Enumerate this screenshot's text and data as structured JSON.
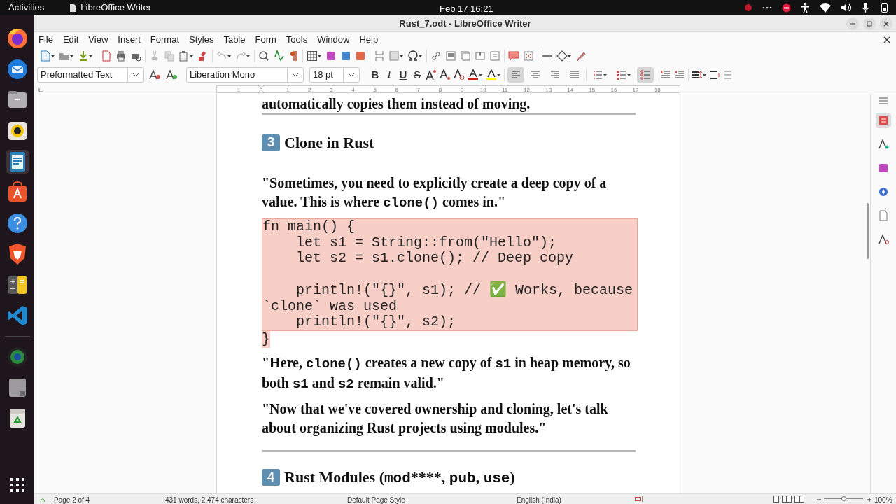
{
  "top_bar": {
    "activities": "Activities",
    "app": "LibreOffice Writer",
    "clock": "Feb 17  16:21"
  },
  "window": {
    "title": "Rust_7.odt - LibreOffice Writer"
  },
  "menu": [
    "File",
    "Edit",
    "View",
    "Insert",
    "Format",
    "Styles",
    "Table",
    "Form",
    "Tools",
    "Window",
    "Help"
  ],
  "formatting": {
    "paragraph_style": "Preformatted Text",
    "font_name": "Liberation Mono",
    "font_size": "18 pt",
    "text_buttons": [
      {
        "kind": "bold",
        "label": "B"
      },
      {
        "kind": "italic",
        "label": "I"
      },
      {
        "kind": "underline",
        "label": "U"
      },
      {
        "kind": "strike",
        "label": "S"
      }
    ],
    "paragraph_buttons": [
      {
        "kind": "align-left",
        "selected": true
      },
      {
        "kind": "align-center",
        "selected": false
      },
      {
        "kind": "align-right",
        "selected": false
      },
      {
        "kind": "justify",
        "selected": false
      },
      {
        "kind": "bullets",
        "selected": false
      },
      {
        "kind": "numbering",
        "selected": false
      },
      {
        "kind": "outline",
        "selected": true
      }
    ]
  },
  "ruler": {
    "left_label": "1",
    "labels": [
      "1",
      "2",
      "3",
      "4",
      "5",
      "6",
      "7",
      "8",
      "9",
      "10",
      "11",
      "12",
      "13",
      "14",
      "15",
      "16",
      "17",
      "18"
    ]
  },
  "document": {
    "blocks": [
      {
        "kind": "cut",
        "text": "automatically copies them instead of moving."
      },
      {
        "kind": "rule"
      },
      {
        "kind": "heading",
        "number": "3",
        "segments": [
          {
            "text": "Clone in Rust",
            "code": false
          }
        ]
      },
      {
        "kind": "paragraph",
        "segments": [
          {
            "text": "\"Sometimes, you need to explicitly create a deep copy of a value. This is where ",
            "code": false
          },
          {
            "text": "clone()",
            "code": true
          },
          {
            "text": " comes in.\"",
            "code": false
          }
        ]
      },
      {
        "kind": "code",
        "lines": [
          {
            "kind": "text",
            "text": "fn main() {"
          },
          {
            "kind": "text",
            "text": "    let s1 = String::from(\"Hello\");"
          },
          {
            "kind": "text",
            "text": "    let s2 = s1.clone(); // Deep copy"
          },
          {
            "kind": "blank"
          },
          {
            "kind": "text",
            "text": "    println!(\"{}\", s1); // ✅ Works, because"
          },
          {
            "kind": "text",
            "text": "`clone` was used"
          },
          {
            "kind": "text",
            "text": "    println!(\"{}\", s2);"
          }
        ],
        "closing": "}"
      },
      {
        "kind": "paragraph",
        "segments": [
          {
            "text": "\"Here, ",
            "code": false
          },
          {
            "text": "clone()",
            "code": true
          },
          {
            "text": " creates a new copy of ",
            "code": false
          },
          {
            "text": "s1",
            "code": true
          },
          {
            "text": " in heap memory, so both ",
            "code": false
          },
          {
            "text": "s1",
            "code": true
          },
          {
            "text": " and ",
            "code": false
          },
          {
            "text": "s2",
            "code": true
          },
          {
            "text": " remain valid.\"",
            "code": false
          }
        ]
      },
      {
        "kind": "paragraph",
        "segments": [
          {
            "text": "\"Now that we've covered ownership and cloning, let's talk about organizing Rust projects using modules.\"",
            "code": false
          }
        ]
      },
      {
        "kind": "rule"
      },
      {
        "kind": "heading",
        "number": "4",
        "segments": [
          {
            "text": "Rust Modules (",
            "code": false
          },
          {
            "text": "mod",
            "code": true
          },
          {
            "text": "****, ",
            "code": false
          },
          {
            "text": "pub",
            "code": true
          },
          {
            "text": ", ",
            "code": false
          },
          {
            "text": "use",
            "code": true
          },
          {
            "text": ")",
            "code": false
          }
        ]
      }
    ]
  },
  "status_bar": {
    "page": "Page 2 of 4",
    "words": "431 words, 2,474 characters",
    "page_style": "Default Page Style",
    "language": "English (India)",
    "zoom": "100%",
    "zoom_level": {
      "level": 0.5
    }
  }
}
